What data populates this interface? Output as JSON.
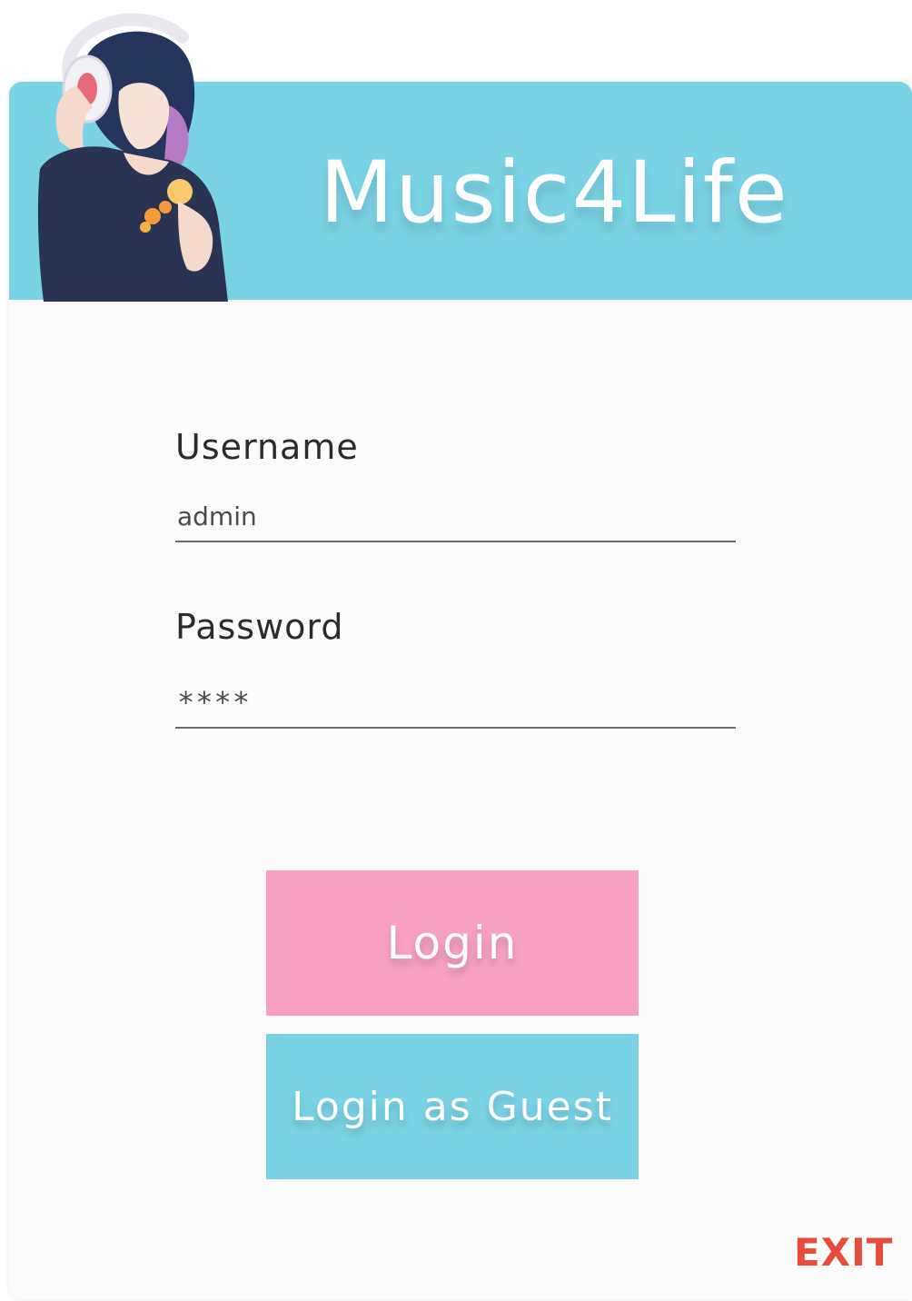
{
  "app": {
    "title": "Music4Life"
  },
  "form": {
    "username_label": "Username",
    "username_value": "admin",
    "password_label": "Password",
    "password_value": "****"
  },
  "buttons": {
    "login_label": "Login",
    "guest_label": "Login as Guest",
    "exit_label": "EXIT"
  },
  "icons": {
    "mascot": "anime-girl-headphones-image"
  },
  "colors": {
    "header": "#7ad3e5",
    "login_button": "#f7a0c4",
    "guest_button": "#7ad3e5",
    "exit": "#e74c3c"
  }
}
